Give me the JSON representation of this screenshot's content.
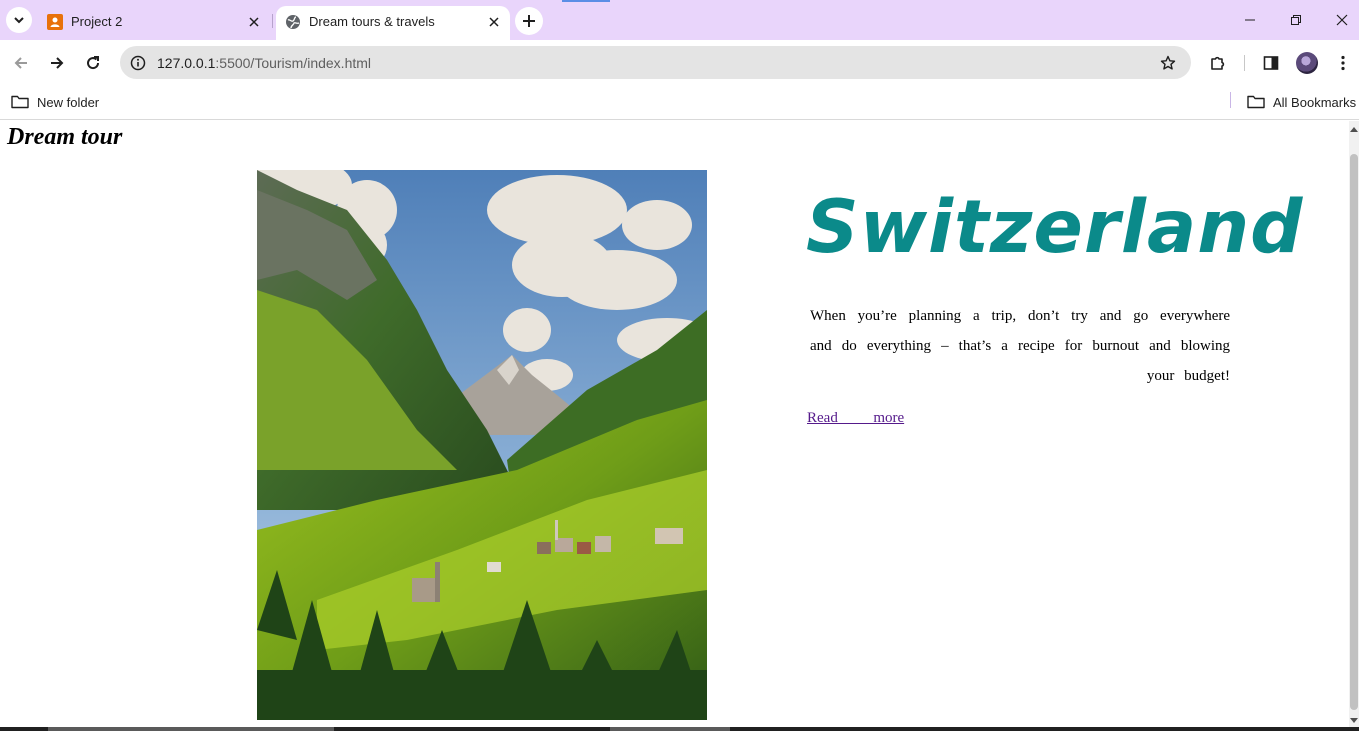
{
  "browser": {
    "tabs": [
      {
        "title": "Project 2",
        "active": false,
        "favicon": "google-sites-icon"
      },
      {
        "title": "Dream tours & travels",
        "active": true,
        "favicon": "globe-icon"
      }
    ],
    "url": {
      "host": "127.0.0.1",
      "path": ":5500/Tourism/index.html"
    },
    "bookmarks": {
      "left": "New folder",
      "right": "All Bookmarks"
    },
    "colors": {
      "tabstrip": "#e9d5fb",
      "omnibox": "#e4e4e4"
    }
  },
  "page": {
    "brand": "Dream tour",
    "headline": "Switzerland",
    "blurb": "When you’re planning a trip, don’t try and go everywhere and do everything – that’s a recipe for burnout and blowing your budget!",
    "read_more": "Read  more",
    "image": "swiss-alpine-valley-photo",
    "colors": {
      "headline": "#0b8a8a",
      "link": "#551a8b"
    }
  }
}
